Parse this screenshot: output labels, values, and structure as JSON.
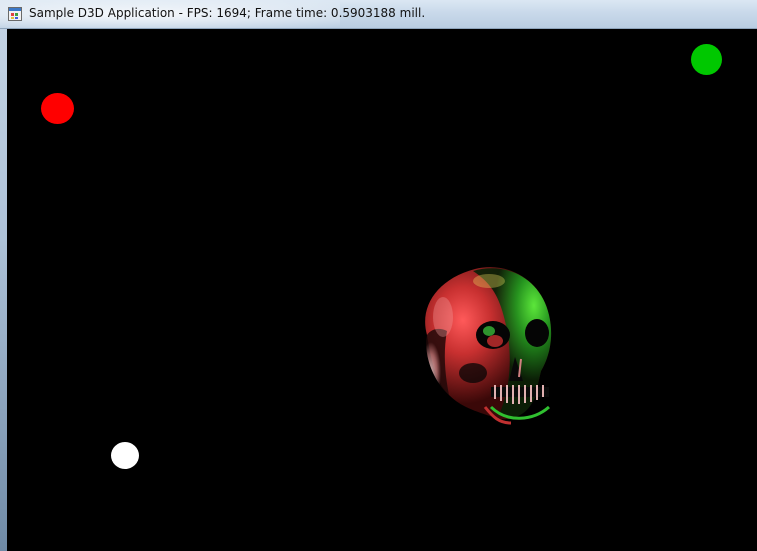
{
  "window": {
    "title": "Sample D3D Application - FPS: 1694; Frame time: 0.5903188 mill."
  },
  "scene": {
    "background_color": "#000000",
    "objects": [
      {
        "name": "red-light-sphere",
        "color": "#ff0000"
      },
      {
        "name": "green-light-sphere",
        "color": "#00c800"
      },
      {
        "name": "white-light-sphere",
        "color": "#ffffff"
      },
      {
        "name": "skull-model",
        "colors": [
          "#d04040",
          "#30c030",
          "#e0b0b0"
        ]
      }
    ]
  },
  "icons": {
    "app_icon": "application-window-icon"
  }
}
